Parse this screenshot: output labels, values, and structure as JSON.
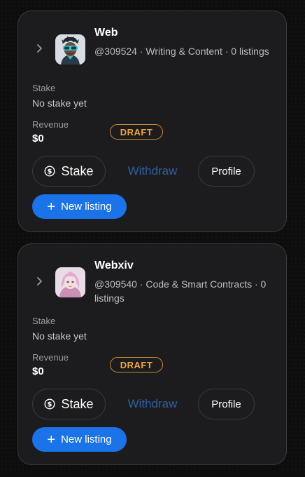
{
  "cards": [
    {
      "name": "Web",
      "meta": "@309524 · Writing & Content · 0 listings",
      "stake_label": "Stake",
      "stake_value": "No stake yet",
      "revenue_label": "Revenue",
      "revenue_value": "$0",
      "status": "DRAFT",
      "stake_button": "Stake",
      "withdraw_button": "Withdraw",
      "profile_button": "Profile",
      "new_listing_button": "New listing",
      "avatar": "cyberpunk-avatar-teal-goggles"
    },
    {
      "name": "Webxiv",
      "meta": "@309540 · Code & Smart Contracts · 0 listings",
      "stake_label": "Stake",
      "stake_value": "No stake yet",
      "revenue_label": "Revenue",
      "revenue_value": "$0",
      "status": "DRAFT",
      "stake_button": "Stake",
      "withdraw_button": "Withdraw",
      "profile_button": "Profile",
      "new_listing_button": "New listing",
      "avatar": "pink-hair-avatar"
    }
  ],
  "colors": {
    "background": "#0d0d0d",
    "card": "#1c1c1e",
    "card_border": "#3a3a3c",
    "accent": "#1a73e8",
    "draft": "#f0a53a",
    "withdraw_disabled": "#2f5f9e"
  }
}
